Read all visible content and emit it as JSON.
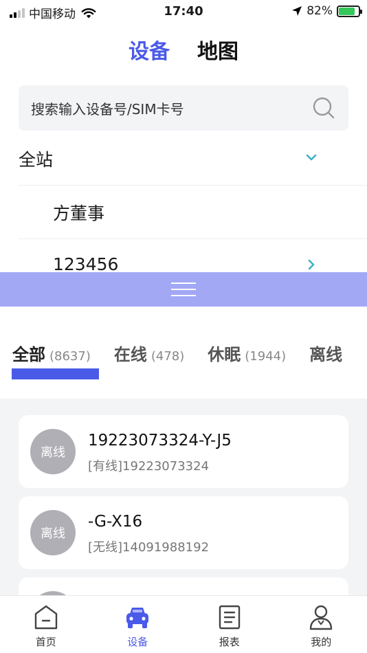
{
  "status_bar": {
    "carrier": "中国移动",
    "time": "17:40",
    "battery": "82%"
  },
  "top_tabs": [
    {
      "label": "设备",
      "active": true
    },
    {
      "label": "地图",
      "active": false
    }
  ],
  "search": {
    "placeholder": "搜索输入设备号/SIM卡号"
  },
  "tree": {
    "root": "全站",
    "children": [
      "方董事",
      "123456"
    ]
  },
  "filter_tabs": [
    {
      "label": "全部",
      "count": "(8637)",
      "active": true
    },
    {
      "label": "在线",
      "count": "(478)",
      "active": false
    },
    {
      "label": "休眠",
      "count": "(1944)",
      "active": false
    },
    {
      "label": "离线",
      "count": "",
      "active": false
    }
  ],
  "devices": [
    {
      "status": "离线",
      "name": "19223073324-Y-J5",
      "sub": "[有线]19223073324"
    },
    {
      "status": "离线",
      "name": "-G-X16",
      "sub": "[无线]14091988192"
    },
    {
      "status": "",
      "name": "",
      "sub": ""
    }
  ],
  "bottom_nav": [
    {
      "label": "首页",
      "icon": "home-icon",
      "active": false
    },
    {
      "label": "设备",
      "icon": "car-icon",
      "active": true
    },
    {
      "label": "报表",
      "icon": "report-icon",
      "active": false
    },
    {
      "label": "我的",
      "icon": "user-icon",
      "active": false
    }
  ],
  "colors": {
    "accent": "#4a5ae8",
    "drag_bar": "#a3a8f5",
    "offline_badge": "#afafb5"
  }
}
